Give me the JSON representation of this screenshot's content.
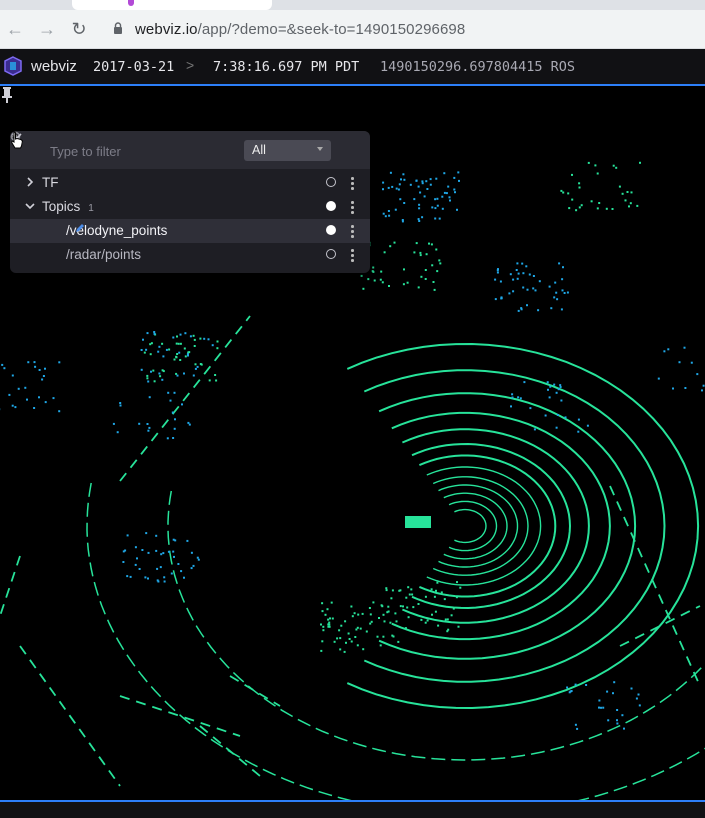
{
  "browser": {
    "url_host": "webviz.io",
    "url_path": "/app/?demo=&seek-to=1490150296698"
  },
  "appbar": {
    "app_name": "webviz",
    "date": "2017-03-21",
    "separator": ">",
    "time": "7:38:16.697 PM PDT",
    "ros_time": "1490150296.697804415 ROS"
  },
  "topic_panel": {
    "filter_placeholder": "Type to filter",
    "filter_value": "",
    "select_value": "All",
    "rows": [
      {
        "label": "TF",
        "expanded": false,
        "visible": false
      },
      {
        "label": "Topics",
        "badge": "1",
        "expanded": true,
        "visible": true
      },
      {
        "label": "/velodyne_points",
        "visible": true,
        "selected": true
      },
      {
        "label": "/radar/points",
        "visible": false
      }
    ]
  },
  "colors": {
    "accent": "#2d7ff9",
    "point_green": "#27e39a",
    "point_blue": "#1fa7e6",
    "panel_bg": "#1e1e24"
  },
  "icons": [
    "back-icon",
    "forward-icon",
    "reload-icon",
    "lock-icon",
    "webviz-logo",
    "pin-icon",
    "search-icon",
    "chevron-down-icon",
    "collapse-icon",
    "chevron-right-icon",
    "visibility-icon",
    "more-icon",
    "edit-icon",
    "pointer-cursor-icon"
  ]
}
